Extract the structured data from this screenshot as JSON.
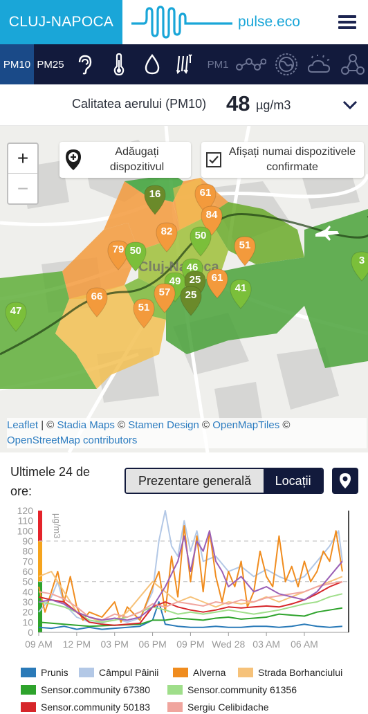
{
  "header": {
    "city": "CLUJ-NAPOCA",
    "brand": "pulse.eco"
  },
  "tabs": [
    {
      "label": "PM10",
      "active": true
    },
    {
      "label": "PM25"
    },
    {
      "icon": "ear-icon"
    },
    {
      "icon": "thermometer-icon"
    },
    {
      "icon": "water-drop-icon"
    },
    {
      "icon": "pressure-icon"
    },
    {
      "label": "PM1"
    },
    {
      "icon": "molecule-icon"
    },
    {
      "icon": "globe-icon"
    },
    {
      "icon": "weather-icon"
    },
    {
      "icon": "network-icon"
    }
  ],
  "quality": {
    "label": "Calitatea aerului (PM10)",
    "value": "48",
    "unit": "µg/m3"
  },
  "map": {
    "zoom_in": "+",
    "zoom_out": "−",
    "add_device": "Adăugați dispozitivul",
    "confirmed_only": "Afișați numai dispozitivele confirmate",
    "city_label": "Cluj-Napoca",
    "markers": [
      {
        "value": "16",
        "color": "#6b8a2a"
      },
      {
        "value": "61",
        "color": "#f39a3c"
      },
      {
        "value": "84",
        "color": "#f39a3c"
      },
      {
        "value": "82",
        "color": "#f39a3c"
      },
      {
        "value": "79",
        "color": "#f39a3c"
      },
      {
        "value": "50",
        "color": "#7bbf3a"
      },
      {
        "value": "50",
        "color": "#7bbf3a"
      },
      {
        "value": "51",
        "color": "#f39a3c"
      },
      {
        "value": "46",
        "color": "#7bbf3a"
      },
      {
        "value": "49",
        "color": "#7bbf3a"
      },
      {
        "value": "25",
        "color": "#6b8a2a"
      },
      {
        "value": "61",
        "color": "#f39a3c"
      },
      {
        "value": "41",
        "color": "#7bbf3a"
      },
      {
        "value": "66",
        "color": "#f39a3c"
      },
      {
        "value": "57",
        "color": "#f39a3c"
      },
      {
        "value": "25",
        "color": "#6b8a2a"
      },
      {
        "value": "51",
        "color": "#f39a3c"
      },
      {
        "value": "47",
        "color": "#7bbf3a"
      },
      {
        "value": "3",
        "color": "#7bbf3a"
      }
    ],
    "attribution": {
      "leaflet": "Leaflet",
      "sep1": " | © ",
      "stadia": "Stadia Maps",
      "sep2": " © ",
      "stamen": "Stamen Design",
      "sep3": " © ",
      "omt": "OpenMapTiles",
      "sep4": " © ",
      "osm": "OpenStreetMap contributors"
    }
  },
  "section": {
    "title_line1": "Ultimele 24 de",
    "title_line2": "ore:",
    "overview": "Prezentare generală",
    "locations": "Locații"
  },
  "chart_data": {
    "type": "line",
    "ylabel": "µg/m3",
    "ylim": [
      0,
      120
    ],
    "yticks": [
      "0",
      "10",
      "20",
      "30",
      "40",
      "50",
      "60",
      "70",
      "80",
      "90",
      "100",
      "110",
      "120"
    ],
    "xticks": [
      "09 AM",
      "12 PM",
      "03 PM",
      "06 PM",
      "09 PM",
      "Wed 28",
      "03 AM",
      "06 AM"
    ],
    "x_hours": [
      0,
      3,
      6,
      9,
      12,
      15,
      18,
      21
    ],
    "x_range": [
      0,
      24.5
    ],
    "series": [
      {
        "name": "Prunis",
        "color": "#2a7ab8",
        "values": [
          [
            0,
            5
          ],
          [
            1,
            4
          ],
          [
            2,
            6
          ],
          [
            3,
            3
          ],
          [
            4,
            5
          ],
          [
            5,
            3
          ],
          [
            6,
            4
          ],
          [
            7,
            5
          ],
          [
            8,
            6
          ],
          [
            9,
            12
          ],
          [
            9.5,
            30
          ],
          [
            10,
            8
          ],
          [
            11,
            6
          ],
          [
            12,
            5
          ],
          [
            13,
            5
          ],
          [
            14,
            6
          ],
          [
            15,
            5
          ],
          [
            16,
            5
          ],
          [
            17,
            6
          ],
          [
            18,
            6
          ],
          [
            19,
            5
          ],
          [
            20,
            6
          ],
          [
            21,
            8
          ],
          [
            22,
            6
          ],
          [
            23,
            5
          ],
          [
            24,
            6
          ]
        ]
      },
      {
        "name": "Câmpul Pâinii",
        "color": "#b3c8e6",
        "values": [
          [
            0,
            20
          ],
          [
            1,
            35
          ],
          [
            1.5,
            50
          ],
          [
            2,
            28
          ],
          [
            3,
            15
          ],
          [
            4,
            10
          ],
          [
            5,
            9
          ],
          [
            6,
            14
          ],
          [
            7,
            10
          ],
          [
            8,
            14
          ],
          [
            9,
            40
          ],
          [
            9.5,
            90
          ],
          [
            10,
            120
          ],
          [
            10.5,
            85
          ],
          [
            11,
            75
          ],
          [
            11.5,
            110
          ],
          [
            12,
            80
          ],
          [
            12.5,
            100
          ],
          [
            13,
            70
          ],
          [
            14,
            75
          ],
          [
            15,
            60
          ],
          [
            16,
            65
          ],
          [
            17,
            55
          ],
          [
            18,
            62
          ],
          [
            19,
            55
          ],
          [
            20,
            50
          ],
          [
            21,
            55
          ],
          [
            22,
            70
          ],
          [
            23,
            85
          ],
          [
            23.7,
            100
          ],
          [
            24,
            70
          ]
        ]
      },
      {
        "name": "Alverna",
        "color": "#f08c1e",
        "values": [
          [
            0,
            45
          ],
          [
            0.5,
            20
          ],
          [
            1,
            40
          ],
          [
            1.5,
            60
          ],
          [
            2,
            30
          ],
          [
            2.5,
            55
          ],
          [
            3,
            25
          ],
          [
            3.5,
            12
          ],
          [
            4,
            20
          ],
          [
            5,
            15
          ],
          [
            6,
            30
          ],
          [
            6.5,
            10
          ],
          [
            7,
            25
          ],
          [
            8,
            12
          ],
          [
            9,
            45
          ],
          [
            9.5,
            60
          ],
          [
            10,
            20
          ],
          [
            10.5,
            75
          ],
          [
            11,
            35
          ],
          [
            11.5,
            105
          ],
          [
            12,
            50
          ],
          [
            12.5,
            95
          ],
          [
            13,
            40
          ],
          [
            13.5,
            100
          ],
          [
            14,
            55
          ],
          [
            14.5,
            30
          ],
          [
            15,
            60
          ],
          [
            15.5,
            45
          ],
          [
            16,
            70
          ],
          [
            16.5,
            25
          ],
          [
            17,
            40
          ],
          [
            17.5,
            80
          ],
          [
            18,
            55
          ],
          [
            18.5,
            45
          ],
          [
            19,
            95
          ],
          [
            19.5,
            50
          ],
          [
            20,
            65
          ],
          [
            20.5,
            45
          ],
          [
            21,
            70
          ],
          [
            21.5,
            50
          ],
          [
            22,
            60
          ],
          [
            22.5,
            80
          ],
          [
            23,
            70
          ],
          [
            23.5,
            100
          ],
          [
            24,
            60
          ]
        ]
      },
      {
        "name": "Strada Borhanciului",
        "color": "#f6c27a",
        "values": [
          [
            0,
            55
          ],
          [
            1,
            60
          ],
          [
            2,
            40
          ],
          [
            3,
            20
          ],
          [
            4,
            15
          ],
          [
            5,
            10
          ],
          [
            6,
            12
          ],
          [
            7,
            20
          ],
          [
            8,
            35
          ],
          [
            9,
            50
          ],
          [
            10,
            40
          ],
          [
            11,
            30
          ],
          [
            12,
            35
          ],
          [
            13,
            30
          ],
          [
            14,
            25
          ],
          [
            15,
            30
          ],
          [
            16,
            28
          ],
          [
            17,
            30
          ],
          [
            18,
            35
          ],
          [
            19,
            30
          ],
          [
            20,
            35
          ],
          [
            21,
            40
          ],
          [
            22,
            45
          ],
          [
            23,
            50
          ],
          [
            24,
            55
          ]
        ]
      },
      {
        "name": "Sensor.community 67380",
        "color": "#2ea32c",
        "values": [
          [
            0,
            10
          ],
          [
            2,
            8
          ],
          [
            4,
            6
          ],
          [
            6,
            7
          ],
          [
            8,
            8
          ],
          [
            9,
            12
          ],
          [
            10,
            12
          ],
          [
            11,
            14
          ],
          [
            12,
            13
          ],
          [
            13,
            12
          ],
          [
            14,
            14
          ],
          [
            15,
            15
          ],
          [
            16,
            13
          ],
          [
            17,
            14
          ],
          [
            18,
            15
          ],
          [
            19,
            18
          ],
          [
            20,
            17
          ],
          [
            21,
            16
          ],
          [
            22,
            20
          ],
          [
            23,
            22
          ],
          [
            24,
            24
          ]
        ]
      },
      {
        "name": "Sensor.community 61356",
        "color": "#9fde8a",
        "values": [
          [
            0,
            30
          ],
          [
            1,
            28
          ],
          [
            2,
            25
          ],
          [
            3,
            20
          ],
          [
            4,
            12
          ],
          [
            5,
            10
          ],
          [
            6,
            12
          ],
          [
            7,
            15
          ],
          [
            8,
            20
          ],
          [
            9,
            25
          ],
          [
            10,
            22
          ],
          [
            11,
            18
          ],
          [
            12,
            20
          ],
          [
            13,
            18
          ],
          [
            14,
            20
          ],
          [
            15,
            22
          ],
          [
            16,
            20
          ],
          [
            17,
            18
          ],
          [
            18,
            20
          ],
          [
            19,
            22
          ],
          [
            20,
            25
          ],
          [
            21,
            28
          ],
          [
            22,
            30
          ],
          [
            23,
            35
          ],
          [
            24,
            38
          ]
        ]
      },
      {
        "name": "Sensor.community 50183",
        "color": "#d6262a",
        "values": [
          [
            0,
            35
          ],
          [
            1,
            32
          ],
          [
            2,
            30
          ],
          [
            3,
            20
          ],
          [
            4,
            10
          ],
          [
            5,
            8
          ],
          [
            6,
            7
          ],
          [
            7,
            8
          ],
          [
            8,
            9
          ],
          [
            9,
            25
          ],
          [
            10,
            30
          ],
          [
            11,
            25
          ],
          [
            12,
            22
          ],
          [
            13,
            20
          ],
          [
            14,
            22
          ],
          [
            15,
            25
          ],
          [
            16,
            24
          ],
          [
            17,
            25
          ],
          [
            18,
            26
          ],
          [
            19,
            25
          ],
          [
            20,
            28
          ],
          [
            21,
            32
          ],
          [
            22,
            38
          ],
          [
            23,
            45
          ],
          [
            24,
            50
          ]
        ]
      },
      {
        "name": "Sergiu Celibidache",
        "color": "#f0a59e",
        "values": [
          [
            0,
            40
          ],
          [
            1,
            38
          ],
          [
            2,
            33
          ],
          [
            3,
            25
          ],
          [
            4,
            15
          ],
          [
            5,
            12
          ],
          [
            6,
            18
          ],
          [
            7,
            15
          ],
          [
            8,
            20
          ],
          [
            9,
            28
          ],
          [
            10,
            25
          ],
          [
            11,
            30
          ],
          [
            12,
            28
          ],
          [
            13,
            26
          ],
          [
            14,
            30
          ],
          [
            15,
            28
          ],
          [
            16,
            32
          ],
          [
            17,
            30
          ],
          [
            18,
            34
          ],
          [
            19,
            36
          ],
          [
            20,
            38
          ],
          [
            21,
            40
          ],
          [
            22,
            45
          ],
          [
            23,
            48
          ],
          [
            24,
            50
          ]
        ]
      },
      {
        "name": "",
        "color": "#9a5fb5",
        "values": [
          [
            0,
            30
          ],
          [
            1,
            32
          ],
          [
            2,
            28
          ],
          [
            3,
            20
          ],
          [
            4,
            15
          ],
          [
            5,
            12
          ],
          [
            6,
            14
          ],
          [
            7,
            12
          ],
          [
            8,
            15
          ],
          [
            9,
            25
          ],
          [
            10,
            45
          ],
          [
            11,
            70
          ],
          [
            11.5,
            95
          ],
          [
            12,
            60
          ],
          [
            12.5,
            90
          ],
          [
            13,
            80
          ],
          [
            13.5,
            100
          ],
          [
            14,
            70
          ],
          [
            14.5,
            60
          ],
          [
            15,
            45
          ],
          [
            16,
            55
          ],
          [
            17,
            40
          ],
          [
            18,
            45
          ],
          [
            19,
            38
          ],
          [
            20,
            35
          ],
          [
            21,
            32
          ],
          [
            22,
            40
          ],
          [
            23,
            55
          ],
          [
            24,
            70
          ]
        ]
      }
    ]
  }
}
